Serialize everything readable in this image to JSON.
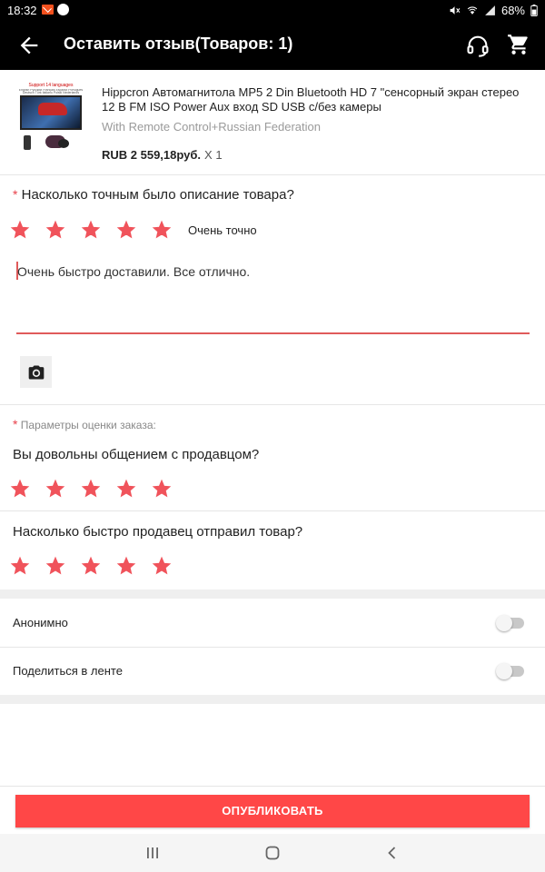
{
  "status_bar": {
    "time": "18:32",
    "battery": "68%"
  },
  "app_bar": {
    "title": "Оставить отзыв(Товаров: 1)"
  },
  "product": {
    "title": "Hippcron Автомагнитола MP5 2 Din Bluetooth HD 7 \"сенсорный экран стерео 12 В FM ISO Power Aux вход SD USB с/без камеры",
    "variant": "With Remote Control+Russian Federation",
    "price": "RUB 2 559,18руб.",
    "quantity": "X 1",
    "thumbnail_text": "Support 14 languages",
    "thumbnail_subtext": "English Русский Français Español Português Deutsch Türk Italiano Polski Nederlands"
  },
  "description_rating": {
    "required_mark": "*",
    "question": "Насколько точным было описание товара?",
    "rating": 5,
    "max": 5,
    "rating_label": "Очень точно"
  },
  "review": {
    "text": "Очень быстро доставили. Все отлично."
  },
  "order_params": {
    "required_mark": "*",
    "label": "Параметры оценки заказа:",
    "questions": [
      {
        "question": "Вы довольны общением с продавцом?",
        "rating": 5,
        "max": 5
      },
      {
        "question": "Насколько быстро продавец отправил товар?",
        "rating": 5,
        "max": 5
      }
    ]
  },
  "toggles": [
    {
      "label": "Анонимно",
      "on": false
    },
    {
      "label": "Поделиться в ленте",
      "on": false
    }
  ],
  "publish_button": {
    "label": "ОПУБЛИКОВАТЬ"
  },
  "colors": {
    "star": "#f0535b",
    "accent": "#ff4747",
    "app_bar": "#000000"
  },
  "icons": {
    "back": "arrow-left-icon",
    "support": "headset-icon",
    "cart": "cart-icon",
    "camera": "camera-icon",
    "star": "star-icon"
  }
}
